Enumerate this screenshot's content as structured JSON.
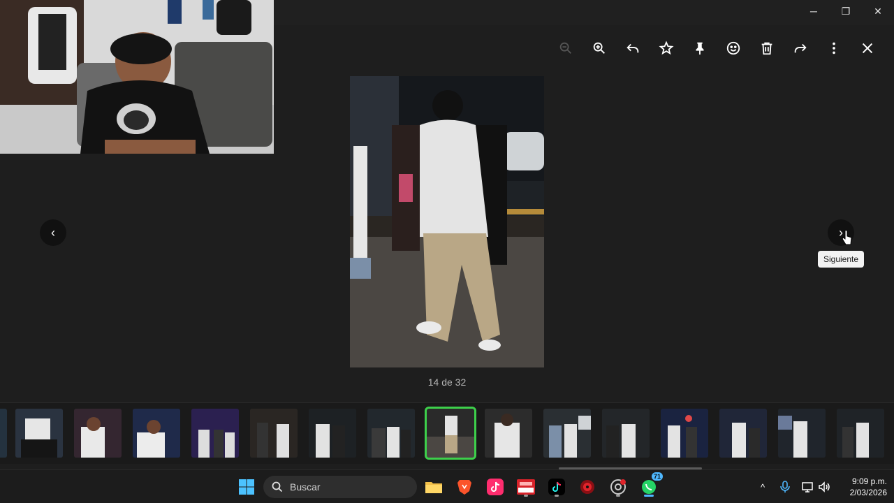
{
  "window": {
    "minimize_glyph": "─",
    "restore_glyph": "❐",
    "close_glyph": "✕"
  },
  "toolbar": {
    "items": [
      {
        "name": "zoom-out",
        "icon": "zoom-out-icon",
        "enabled": false
      },
      {
        "name": "zoom-in",
        "icon": "zoom-in-icon",
        "enabled": true
      },
      {
        "name": "reply",
        "icon": "reply-icon",
        "enabled": true
      },
      {
        "name": "star",
        "icon": "star-icon",
        "enabled": true
      },
      {
        "name": "pin",
        "icon": "pin-icon",
        "enabled": true
      },
      {
        "name": "react",
        "icon": "emoji-icon",
        "enabled": true
      },
      {
        "name": "delete",
        "icon": "trash-icon",
        "enabled": true
      },
      {
        "name": "forward",
        "icon": "forward-icon",
        "enabled": true
      },
      {
        "name": "more",
        "icon": "more-vertical-icon",
        "enabled": true
      },
      {
        "name": "close",
        "icon": "close-icon",
        "enabled": true
      }
    ]
  },
  "viewer": {
    "counter": "14 de 32",
    "prev_glyph": "‹",
    "next_glyph": "›",
    "next_tooltip": "Siguiente"
  },
  "filmstrip": {
    "active_index": 7,
    "accent": "#3dd04b"
  },
  "taskbar": {
    "search_placeholder": "Buscar",
    "whatsapp_badge": "71",
    "clock_time": "9:09 p.m.",
    "clock_date": "2/03/2026",
    "tray_expand_glyph": "^"
  },
  "colors": {
    "background": "#1e1e1e",
    "taskbar": "#1c1c1c",
    "tooltip_bg": "#f3f3f3"
  }
}
